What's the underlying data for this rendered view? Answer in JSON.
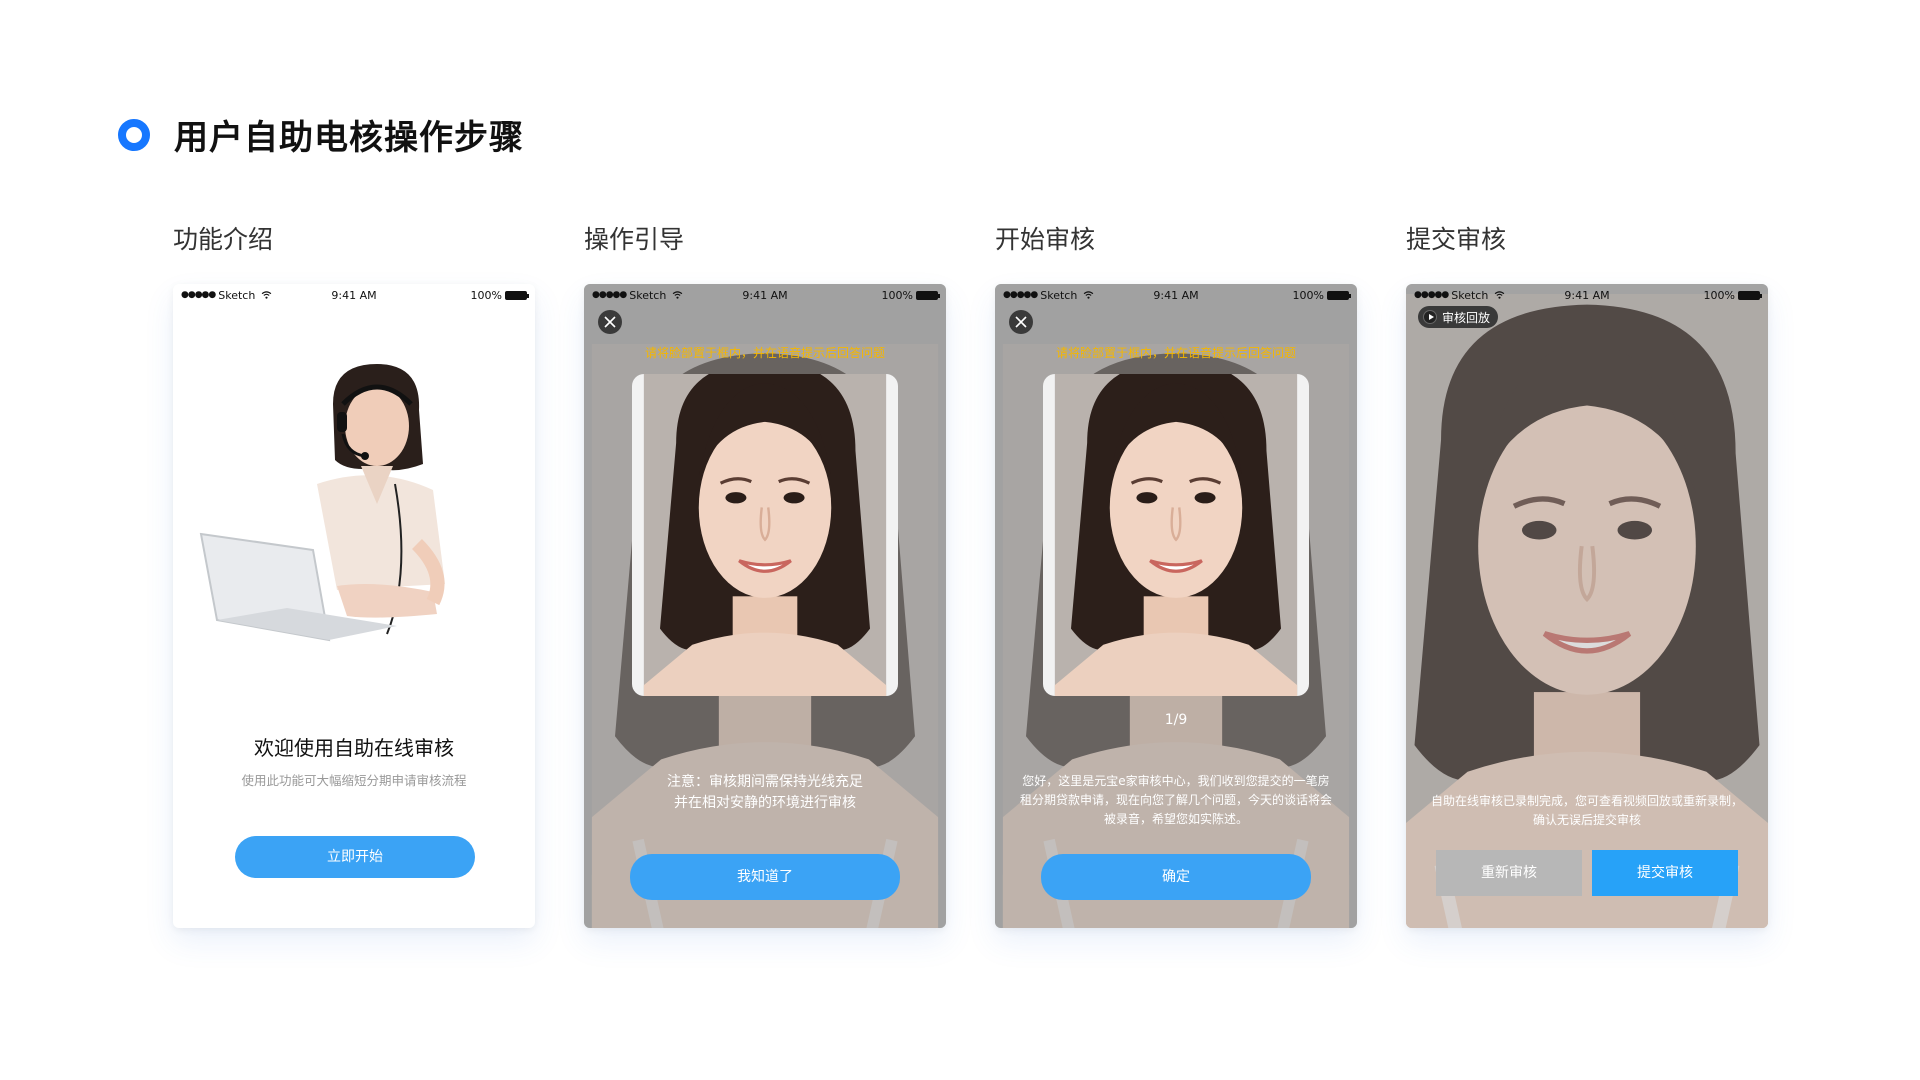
{
  "header": {
    "title": "用户自助电核操作步骤"
  },
  "status_bar": {
    "carrier": "Sketch",
    "signal": "●●●●●",
    "time": "9:41 AM",
    "battery": "100%"
  },
  "steps": [
    {
      "label": "功能介绍",
      "heading": "欢迎使用自助在线审核",
      "subtitle": "使用此功能可大幅缩短分期申请审核流程",
      "button": "立即开始"
    },
    {
      "label": "操作引导",
      "guide": "请将脸部置于框内，并在语音提示后回答问题",
      "notice": "注意：审核期间需保持光线充足\n并在相对安静的环境进行审核",
      "button": "我知道了"
    },
    {
      "label": "开始审核",
      "guide": "请将脸部置于框内，并在语音提示后回答问题",
      "counter": "1/9",
      "notice": "您好，这里是元宝e家审核中心，我们收到您提交的一笔房租分期贷款申请，现在向您了解几个问题，今天的谈话将会被录音，希望您如实陈述。",
      "button": "确定"
    },
    {
      "label": "提交审核",
      "badge": "审核回放",
      "notice": "自助在线审核已录制完成，您可查看视频回放或重新录制，确认无误后提交审核",
      "button_redo": "重新审核",
      "button_submit": "提交审核"
    }
  ],
  "colors": {
    "accent": "#1677ff",
    "button": "#3ba3f5",
    "guide": "#f5b700",
    "overlay": "#a8a8a8"
  }
}
